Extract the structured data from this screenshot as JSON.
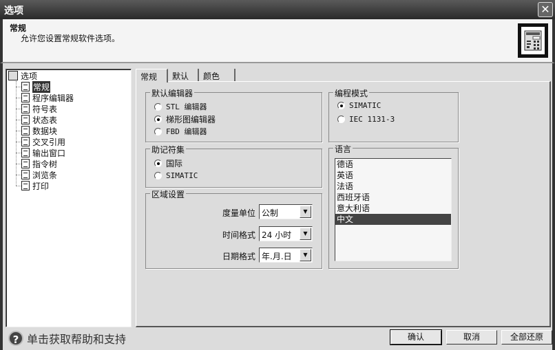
{
  "window": {
    "title": "选项",
    "close_icon": "close-icon"
  },
  "header": {
    "title": "常规",
    "description": "允许您设置常规软件选项。",
    "icon": "settings-panel-icon"
  },
  "tree": {
    "root": "选项",
    "items": [
      "常规",
      "程序编辑器",
      "符号表",
      "状态表",
      "数据块",
      "交叉引用",
      "输出窗口",
      "指令树",
      "浏览条",
      "打印"
    ],
    "selected": "常规"
  },
  "tabs": [
    {
      "label": "常规",
      "active": true
    },
    {
      "label": "默认"
    },
    {
      "label": "颜色"
    }
  ],
  "default_editor": {
    "title": "默认编辑器",
    "options": [
      "STL 编辑器",
      "梯形图编辑器",
      "FBD 编辑器"
    ],
    "selected_index": 1
  },
  "mnemonic": {
    "title": "助记符集",
    "options": [
      "国际",
      "SIMATIC"
    ],
    "selected_index": 0
  },
  "region": {
    "title": "区域设置",
    "fields": [
      {
        "label": "度量单位",
        "value": "公制"
      },
      {
        "label": "时间格式",
        "value": "24 小时"
      },
      {
        "label": "日期格式",
        "value": "年.月.日"
      }
    ]
  },
  "programming_mode": {
    "title": "编程模式",
    "options": [
      "SIMATIC",
      "IEC 1131-3"
    ],
    "selected_index": 0
  },
  "language": {
    "title": "语言",
    "items": [
      "德语",
      "英语",
      "法语",
      "西班牙语",
      "意大利语",
      "中文"
    ],
    "selected": "中文"
  },
  "footer": {
    "help_text": "单击获取帮助和支持",
    "ok": "确认",
    "cancel": "取消",
    "reset_all": "全部还原"
  }
}
